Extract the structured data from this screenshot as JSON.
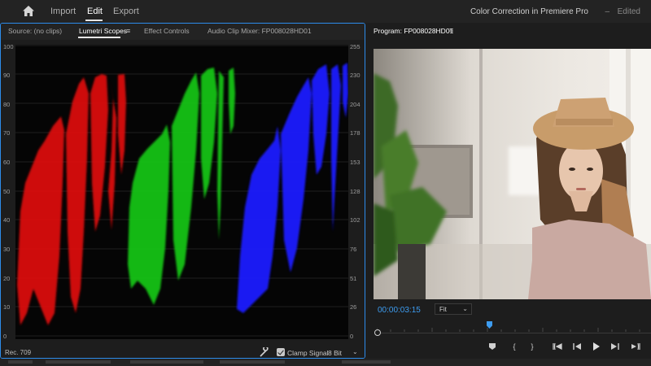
{
  "app": {
    "nav": [
      "Import",
      "Edit",
      "Export"
    ],
    "active_nav": "Edit",
    "document_title": "Color Correction in Premiere Pro",
    "document_status": "Edited"
  },
  "scope_panel": {
    "tabs": [
      "Source: (no clips)",
      "Lumetri Scopes",
      "Effect Controls",
      "Audio Clip Mixer: FP008028HD01"
    ],
    "active_tab": "Lumetri Scopes",
    "left_ticks": [
      "100",
      "90",
      "80",
      "70",
      "60",
      "50",
      "40",
      "30",
      "20",
      "10",
      "0"
    ],
    "right_ticks": [
      "255",
      "230",
      "204",
      "178",
      "153",
      "128",
      "102",
      "76",
      "51",
      "26",
      "0"
    ],
    "color_space": "Rec. 709",
    "clamp_label": "Clamp Signal",
    "clamp_checked": true,
    "bit_depth": "8 Bit",
    "colors": {
      "red": "#e01010",
      "green": "#14c814",
      "blue": "#1a1aff",
      "accent": "#2d8ceb"
    }
  },
  "program_panel": {
    "title": "Program: FP008028HD01",
    "timecode": "00:00:03:15",
    "zoom": "Fit",
    "icons": [
      "marker-icon",
      "mark-in-icon",
      "mark-out-icon",
      "go-to-in-icon",
      "step-back-icon",
      "play-icon",
      "step-forward-icon",
      "go-to-out-icon"
    ]
  }
}
